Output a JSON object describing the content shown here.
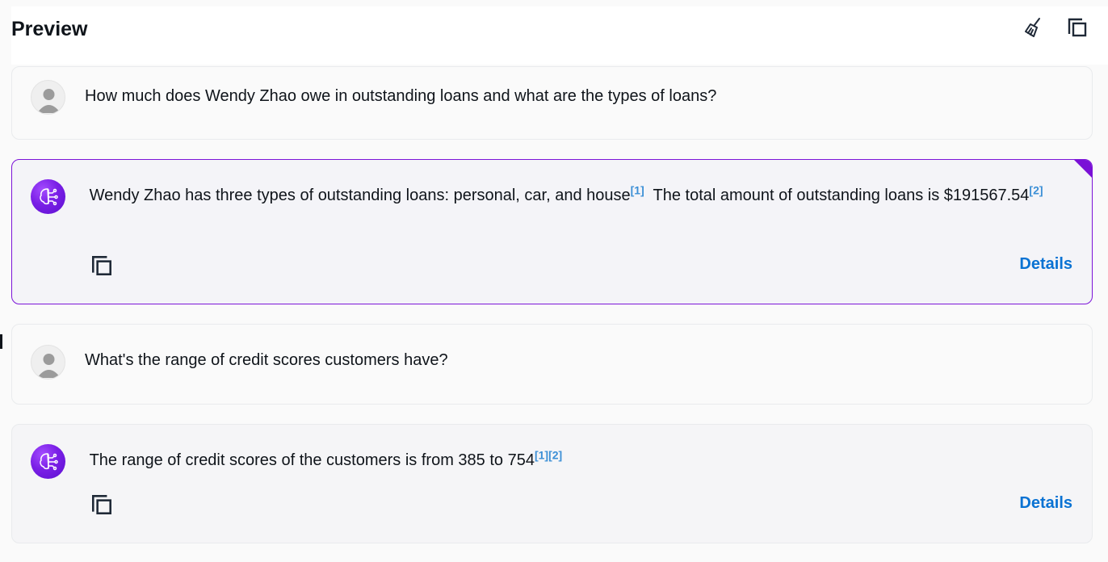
{
  "header": {
    "title": "Preview",
    "clear_icon": "broom-icon",
    "copy_icon": "copy-icon"
  },
  "messages": [
    {
      "role": "user",
      "text": "How much does Wendy Zhao owe in outstanding loans and what are the types of loans?"
    },
    {
      "role": "assistant",
      "part1": "Wendy Zhao has three types of outstanding loans: personal, car, and house",
      "cite1": "[1]",
      "part2": " The total amount of outstanding loans is $191567.54",
      "cite2": "[2]",
      "details_label": "Details"
    },
    {
      "role": "user",
      "text": "What's the range of credit scores customers have?"
    },
    {
      "role": "assistant",
      "part1": "The range of credit scores of the customers is from 385 to 754",
      "cite1": "[1]",
      "cite2": "[2]",
      "details_label": "Details"
    }
  ],
  "colors": {
    "accent": "#7c14d8",
    "link": "#0972d3",
    "citation": "#3b8fd6"
  }
}
